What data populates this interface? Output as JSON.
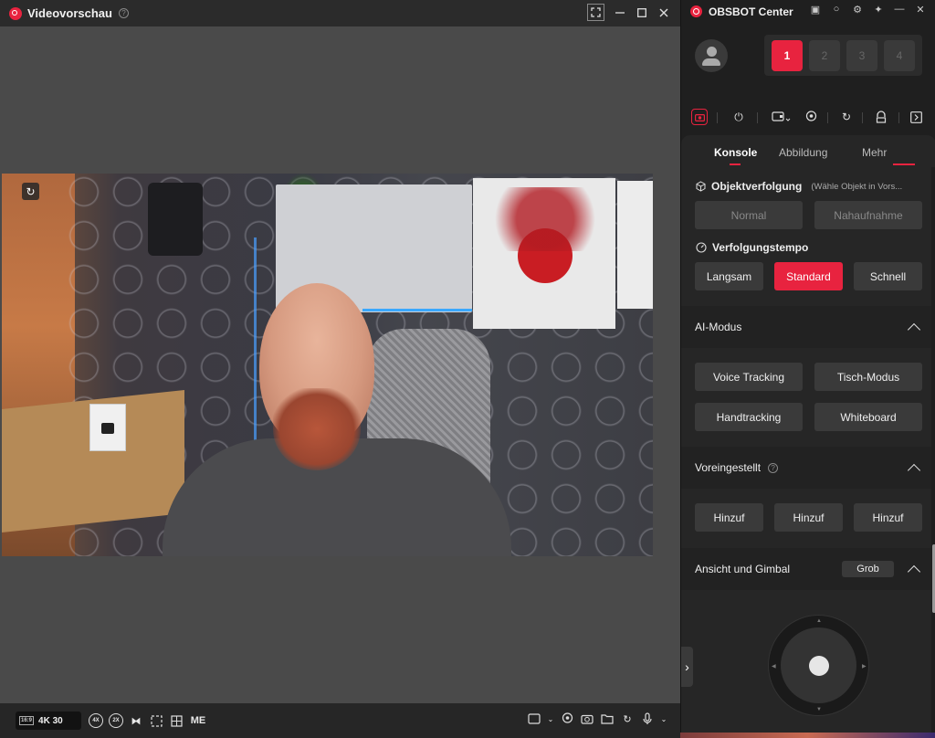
{
  "preview": {
    "title": "Videovorschau",
    "help_glyph": "?",
    "resolution_aspect": "16:9",
    "resolution_label": "4K 30",
    "bottom_tools": [
      "4X",
      "2X",
      "ME"
    ]
  },
  "panel": {
    "title": "OBSBOT Center",
    "devices": [
      "1",
      "2",
      "3",
      "4"
    ],
    "tabs": [
      "Konsole",
      "Abbildung",
      "Mehr"
    ],
    "tracking": {
      "label": "Objektverfolgung",
      "hint": "(Wähle Objekt in Vors...",
      "modes": [
        "Normal",
        "Nahaufnahme"
      ]
    },
    "speed": {
      "label": "Verfolgungstempo",
      "options": [
        "Langsam",
        "Standard",
        "Schnell"
      ],
      "selected": "Standard"
    },
    "ai_mode": {
      "title": "AI-Modus",
      "buttons": [
        "Voice Tracking",
        "Tisch-Modus",
        "Handtracking",
        "Whiteboard"
      ]
    },
    "presets": {
      "title": "Voreingestellt",
      "buttons": [
        "Hinzuf",
        "Hinzuf",
        "Hinzuf"
      ]
    },
    "gimbal": {
      "title": "Ansicht und Gimbal",
      "speed_label": "Grob"
    }
  },
  "colors": {
    "accent": "#e8233f",
    "panel_bg": "#262626",
    "button_bg": "#3a3a3a"
  }
}
